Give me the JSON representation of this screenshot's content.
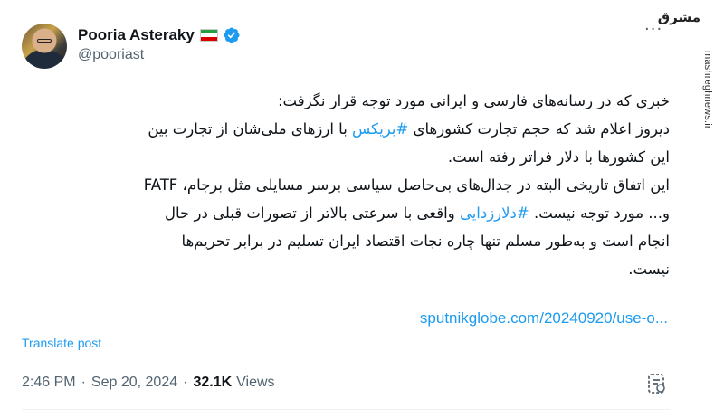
{
  "author": {
    "display_name": "Pooria Asteraky",
    "handle": "@pooriast",
    "flag_icon": "iran-flag-icon",
    "verified_icon": "verified-badge-icon"
  },
  "watermark": {
    "logo_text": "مشرق",
    "url": "mashreghnews.ir"
  },
  "post": {
    "lines": [
      {
        "text": "خبری که در رسانه‌های فارسی و ایرانی مورد توجه قرار نگرفت:"
      },
      {
        "before": "دیروز اعلام شد که حجم تجارت کشورهای ",
        "hashtag": "#بریکس",
        "after": " با ارزهای ملی‌شان از تجارت بین"
      },
      {
        "text": "این کشورها با دلار فراتر رفته است."
      },
      {
        "text": "این اتفاق تاریخی البته در جدال‌های بی‌حاصل سیاسی برسر مسایلی مثل برجام، FATF"
      },
      {
        "before": "و... مورد توجه نیست. ",
        "hashtag": "#دلارزدایی",
        "after": " واقعی با سرعتی بالاتر از تصورات قبلی در حال"
      },
      {
        "text": "انجام است و به‌طور مسلم تنها چاره نجات اقتصاد ایران تسلیم در برابر تحریم‌ها"
      },
      {
        "text": "نیست."
      }
    ],
    "link_text": "sputnikglobe.com/20240920/use-o..."
  },
  "translate_label": "Translate post",
  "meta": {
    "time": "2:46 PM",
    "separator": "·",
    "date": "Sep 20, 2024",
    "views_count": "32.1K",
    "views_label": "Views"
  },
  "colors": {
    "accent": "#1d9bf0",
    "text": "#0f1419",
    "muted": "#536471"
  }
}
